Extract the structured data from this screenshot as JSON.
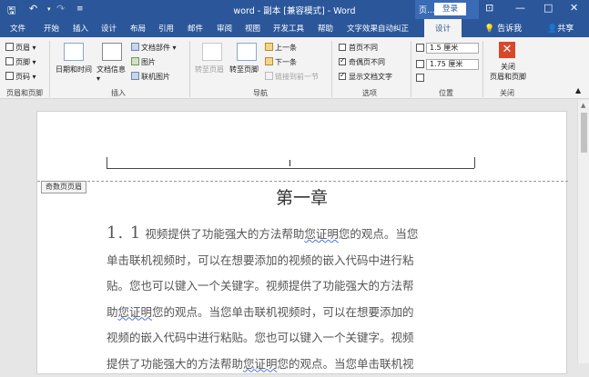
{
  "titlebar": {
    "title": "word - 副本 [兼容模式] - Word",
    "context_tab": "页...",
    "login": "登录",
    "colors": {
      "bar": "#2b579a",
      "context": "#3a6bb5"
    }
  },
  "tabs": [
    "文件",
    "开始",
    "插入",
    "设计",
    "布局",
    "引用",
    "邮件",
    "审阅",
    "视图",
    "开发工具",
    "帮助",
    "文字效果自动纠正",
    "设计"
  ],
  "tell_me": "告诉我",
  "share": "共享",
  "ribbon": {
    "header_footer": {
      "header": "页眉",
      "footer": "页脚",
      "page_number": "页码",
      "group": "页眉和页脚"
    },
    "insert": {
      "datetime": "日期和时间",
      "docinfo": "文档信息",
      "doc_parts": "文档部件",
      "picture": "图片",
      "online_picture": "联机图片",
      "group": "插入"
    },
    "navigation": {
      "goto_header": "转至页眉",
      "goto_footer": "转至页脚",
      "prev": "上一条",
      "next": "下一条",
      "link_prev": "链接到前一节",
      "group": "导航"
    },
    "options": {
      "first_page": "首页不同",
      "odd_even": "奇偶页不同",
      "show_text": "显示文档文字",
      "group": "选项"
    },
    "position": {
      "header_pos": "1.5 厘米",
      "footer_pos": "1.75 厘米",
      "group": "位置"
    },
    "close": {
      "label": "关闭",
      "label2": "页眉和页脚",
      "group": "关闭"
    }
  },
  "document": {
    "header_tag": "奇数页页眉",
    "chapter": "第一章",
    "paragraph": {
      "num": "1. 1",
      "l1a": "视频提供了功能强大的方法帮助",
      "l1u": "您证明",
      "l1b": "您的观点。当您",
      "l2": "单击联机视频时，可以在想要添加的视频的嵌入代码中进行粘",
      "l3": "贴。您也可以键入一个关键字。视频提供了功能强大的方法帮",
      "l4a": "助",
      "l4u": "您证明",
      "l4b": "您的观点。当您单击联机视频时，可以在想要添加的",
      "l5": "视频的嵌入代码中进行粘贴。您也可以键入一个关键字。视频",
      "l6a": "提供了功能强大的方法帮助",
      "l6u": "您证明",
      "l6b": "您的观点。当您单击联机视"
    }
  }
}
